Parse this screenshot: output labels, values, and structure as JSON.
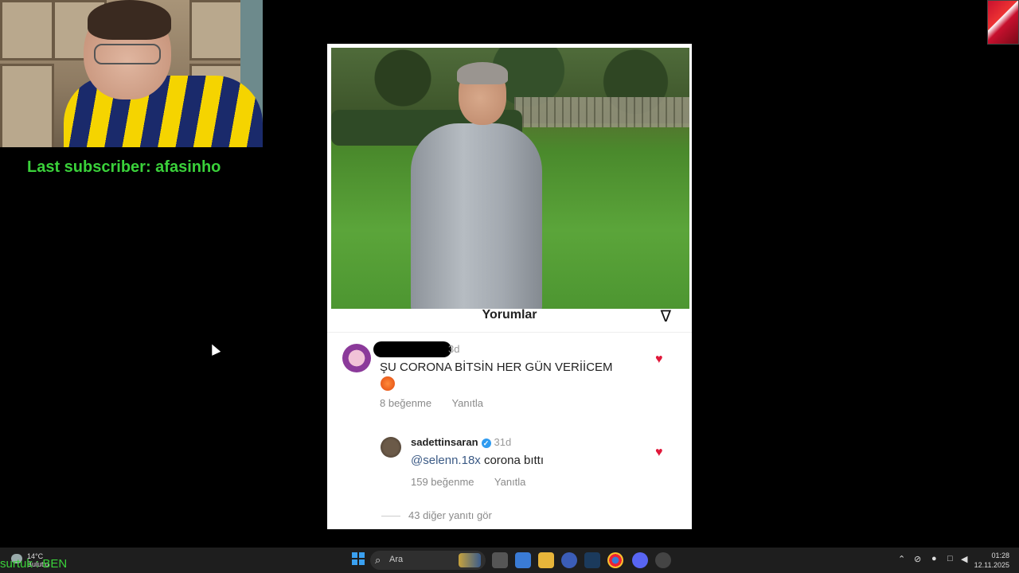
{
  "overlay": {
    "subscriber_text": "Last subscriber: afasinho",
    "bottom_text": "surtuk : BEN"
  },
  "post": {
    "comments_header": "Yorumlar",
    "comment1": {
      "time": "3d",
      "text": "ŞU CORONA BİTSİN HER GÜN VERİİCEM",
      "likes": "8 beğenme",
      "reply_label": "Yanıtla"
    },
    "reply": {
      "username": "sadettinsaran",
      "time": "31d",
      "mention": "@selenn.18x",
      "text": " corona bıttı",
      "likes": "159 beğenme",
      "reply_label": "Yanıtla"
    },
    "more_replies": "43 diğer yanıtı gör"
  },
  "taskbar": {
    "weather_temp": "14°C",
    "weather_desc": "Bulutlu",
    "search_placeholder": "Ara",
    "time": "01:28",
    "date": "12.11.2025"
  },
  "colors": {
    "overlay_green": "#3ad13a",
    "heart_red": "#e0183a",
    "verified_blue": "#2f9bf0"
  }
}
